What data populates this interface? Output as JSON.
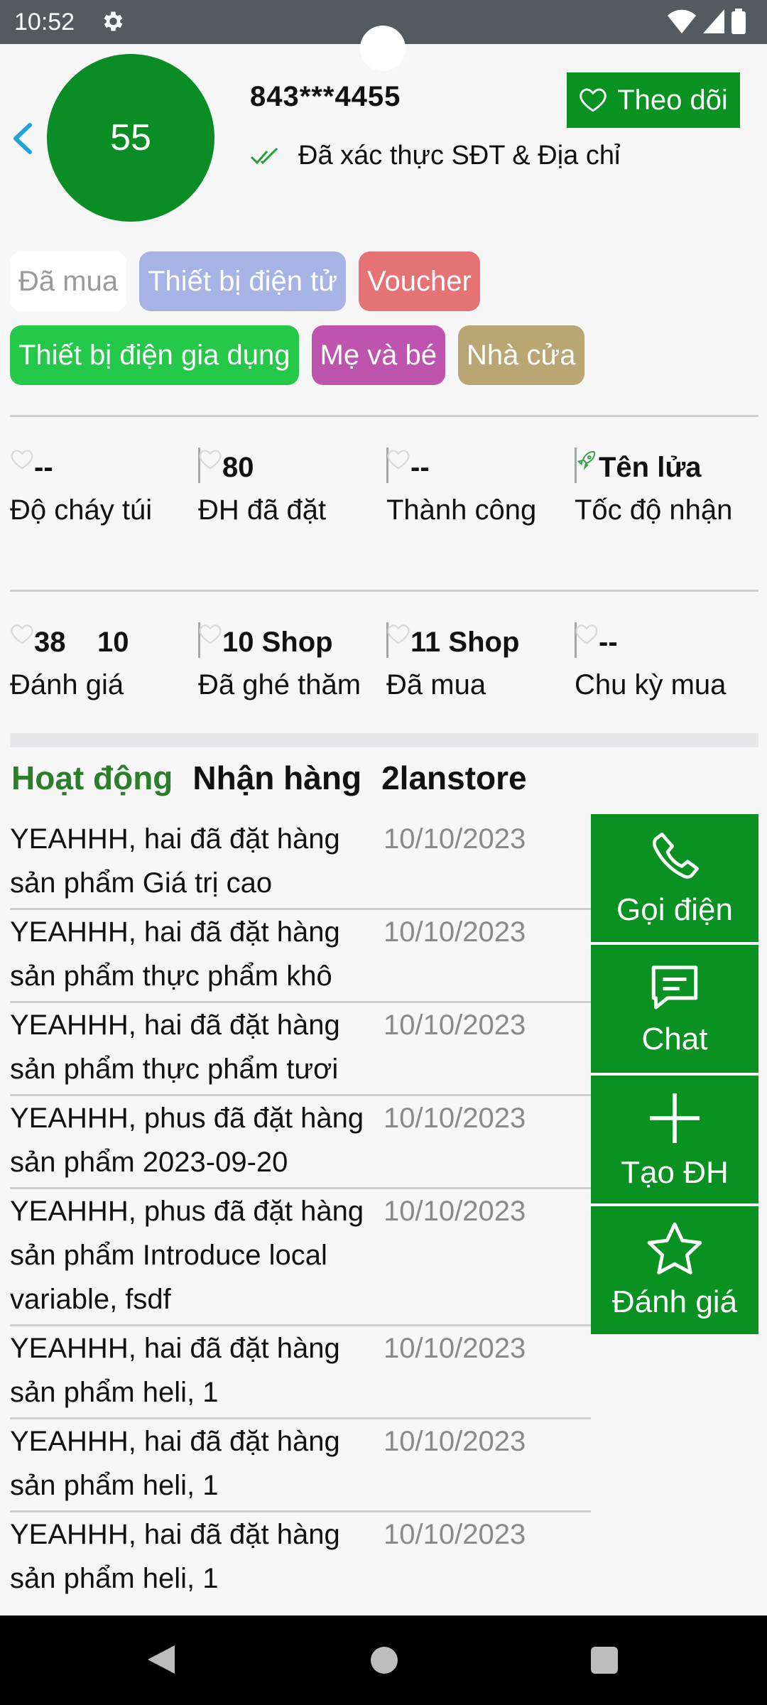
{
  "status_bar": {
    "time": "10:52"
  },
  "header": {
    "avatar_text": "55",
    "phone": "843***4455",
    "verified_text": "Đã xác thực SĐT & Địa chỉ",
    "follow_label": "Theo dõi"
  },
  "tags": [
    {
      "label": "Đã mua",
      "bg": "#ffffff",
      "color": "#9a9a9a"
    },
    {
      "label": "Thiết bị điện tử",
      "bg": "#a7b3e4",
      "color": "#ffffff"
    },
    {
      "label": "Voucher",
      "bg": "#e57373",
      "color": "#ffffff"
    },
    {
      "label": "Thiết bị điện gia dụng",
      "bg": "#25c94a",
      "color": "#ffffff"
    },
    {
      "label": "Mẹ và bé",
      "bg": "#bf54ae",
      "color": "#ffffff"
    },
    {
      "label": "Nhà cửa",
      "bg": "#b9a672",
      "color": "#ffffff"
    }
  ],
  "stats_row1": [
    {
      "value": "--",
      "label": "Độ cháy túi"
    },
    {
      "value": "80",
      "label": "ĐH đã đặt"
    },
    {
      "value": "--",
      "label": "Thành công"
    },
    {
      "value": "Tên lửa",
      "label": "Tốc độ nhận"
    }
  ],
  "stats_row2": [
    {
      "value": "38    10",
      "label": "Đánh giá"
    },
    {
      "value": "10 Shop",
      "label": "Đã ghé thăm"
    },
    {
      "value": "11 Shop",
      "label": "Đã mua"
    },
    {
      "value": "--",
      "label": "Chu kỳ mua"
    }
  ],
  "tabs": {
    "activity": "Hoạt động",
    "receive": "Nhận hàng",
    "store": "2lanstore"
  },
  "activities": [
    {
      "text": "YEAHHH, hai đã đặt hàng sản phẩm Giá trị cao",
      "date": "10/10/2023"
    },
    {
      "text": "YEAHHH, hai đã đặt hàng sản phẩm thực phẩm khô",
      "date": "10/10/2023"
    },
    {
      "text": "YEAHHH, hai đã đặt hàng sản phẩm thực phẩm tươi",
      "date": "10/10/2023"
    },
    {
      "text": "YEAHHH, phus đã đặt hàng sản phẩm 2023-09-20",
      "date": "10/10/2023"
    },
    {
      "text": "YEAHHH, phus đã đặt hàng sản phẩm Introduce local variable, fsdf",
      "date": "10/10/2023"
    },
    {
      "text": "YEAHHH, hai đã đặt hàng sản phẩm heli, 1",
      "date": "10/10/2023"
    },
    {
      "text": "YEAHHH, hai đã đặt hàng sản phẩm heli, 1",
      "date": "10/10/2023"
    },
    {
      "text": "YEAHHH, hai đã đặt hàng sản phẩm heli, 1",
      "date": "10/10/2023"
    }
  ],
  "actions": {
    "call": "Gọi điện",
    "chat": "Chat",
    "create_order": "Tạo ĐH",
    "review": "Đánh giá"
  }
}
